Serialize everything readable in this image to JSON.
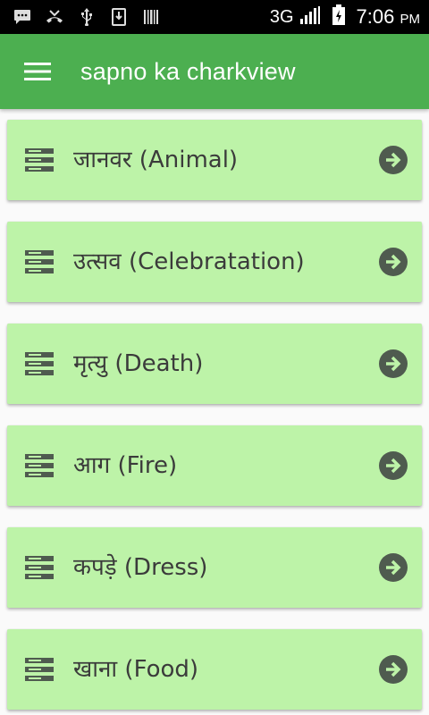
{
  "status_bar": {
    "network": "3G",
    "time": "7:06",
    "ampm": "PM"
  },
  "app_bar": {
    "title": "sapno ka charkview"
  },
  "categories": [
    {
      "label": "जानवर (Animal)"
    },
    {
      "label": "उत्सव (Celebratation)"
    },
    {
      "label": "मृत्यु (Death)"
    },
    {
      "label": "आग (Fire)"
    },
    {
      "label": "कपड़े (Dress)"
    },
    {
      "label": "खाना (Food)"
    }
  ],
  "colors": {
    "app_bar": "#4caf50",
    "card": "#bdf3a8",
    "icon": "#4f5b4f"
  },
  "icons": {
    "menu": "hamburger-menu-icon",
    "card_leading": "list-icon",
    "card_trailing": "arrow-circle-right-icon"
  }
}
